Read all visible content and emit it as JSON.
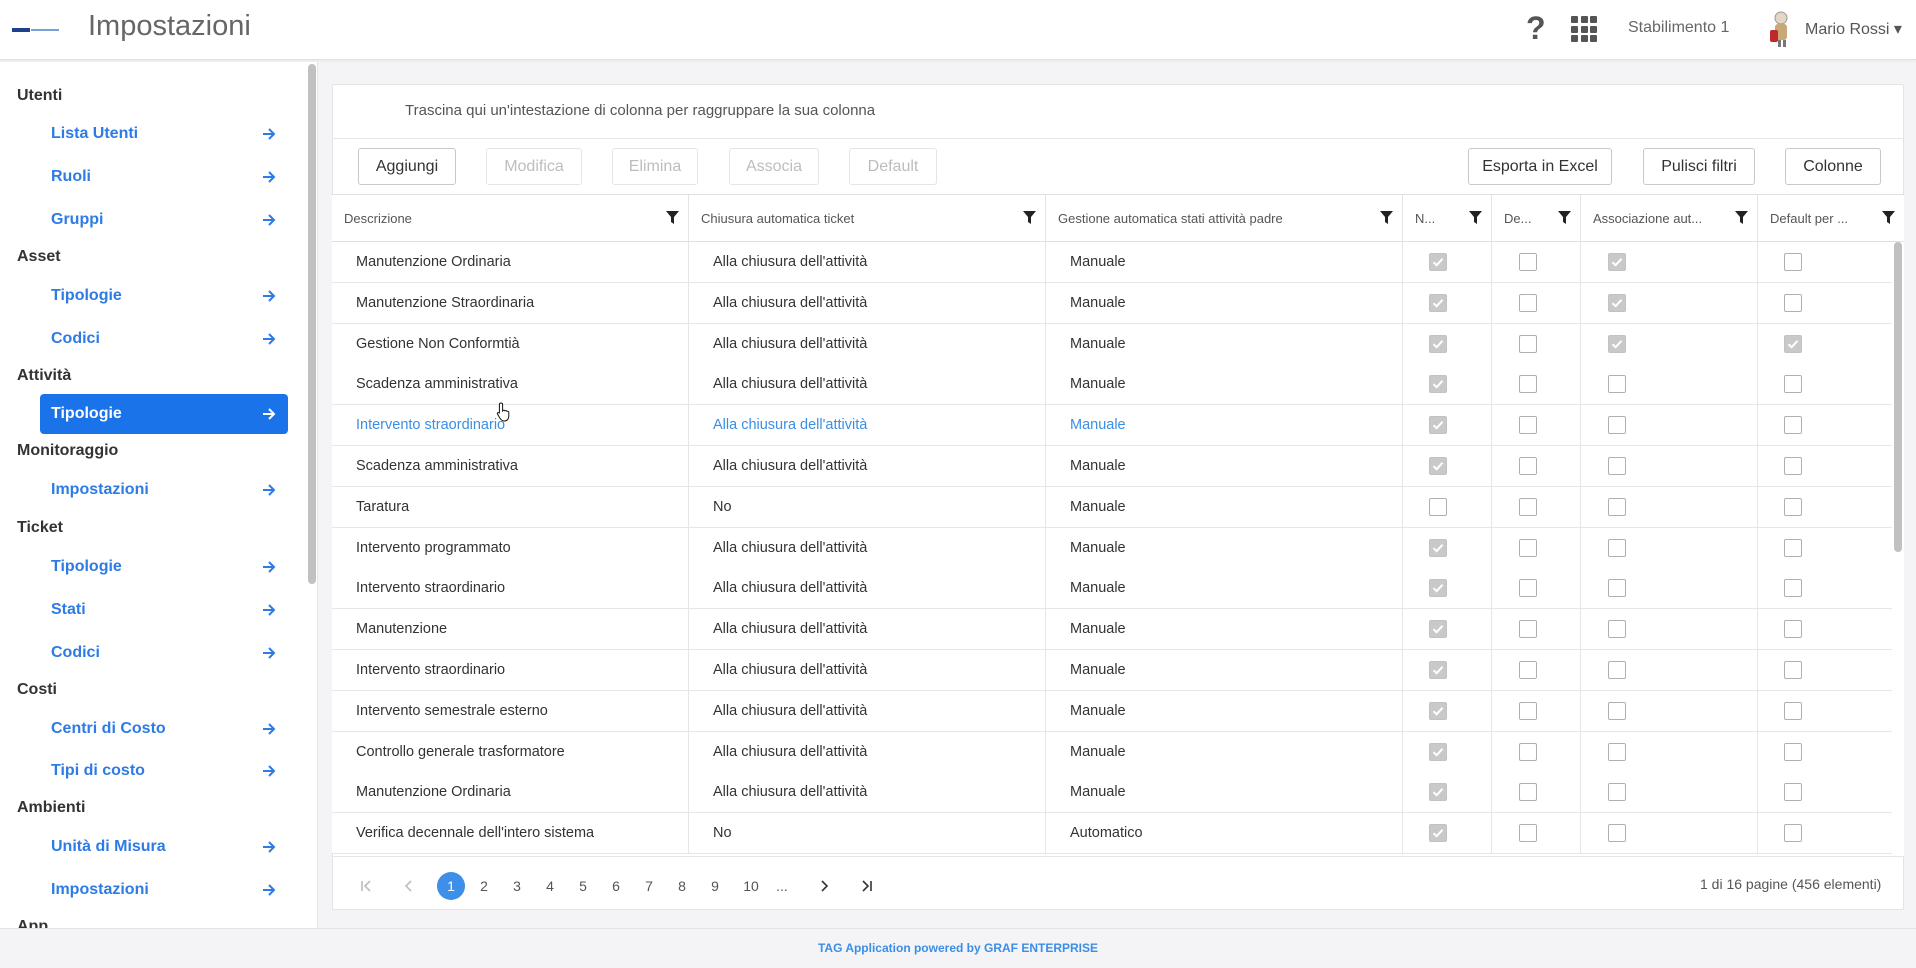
{
  "header": {
    "title": "Impostazioni",
    "help_symbol": "?",
    "plant": "Stabilimento 1",
    "user": "Mario Rossi ▾"
  },
  "sidebar": {
    "sections": [
      {
        "title": "Utenti",
        "items": [
          "Lista Utenti",
          "Ruoli",
          "Gruppi"
        ]
      },
      {
        "title": "Asset",
        "items": [
          "Tipologie",
          "Codici"
        ]
      },
      {
        "title": "Attività",
        "items": [
          "Tipologie"
        ]
      },
      {
        "title": "Monitoraggio",
        "items": [
          "Impostazioni"
        ]
      },
      {
        "title": "Ticket",
        "items": [
          "Tipologie",
          "Stati",
          "Codici"
        ]
      },
      {
        "title": "Costi",
        "items": [
          "Centri di Costo",
          "Tipi di costo"
        ]
      },
      {
        "title": "Ambienti",
        "items": [
          "Unità di Misura",
          "Impostazioni"
        ]
      },
      {
        "title": "App",
        "items": []
      }
    ],
    "active": "Attività/Tipologie"
  },
  "toolbar": {
    "group_hint": "Trascina qui un'intestazione di colonna per raggruppare la sua colonna",
    "add": "Aggiungi",
    "edit": "Modifica",
    "delete": "Elimina",
    "associate": "Associa",
    "default": "Default",
    "export": "Esporta in Excel",
    "clear_filters": "Pulisci filtri",
    "columns": "Colonne"
  },
  "grid": {
    "columns": [
      "Descrizione",
      "Chiusura automatica ticket",
      "Gestione automatica stati attività padre",
      "N...",
      "De...",
      "Associazione aut...",
      "Default per ..."
    ],
    "rows": [
      {
        "desc": "Manutenzione Ordinaria",
        "chiusura": "Alla chiusura dell'attività",
        "gestione": "Manuale",
        "n": true,
        "de": false,
        "assoc": true,
        "def": false
      },
      {
        "desc": "Manutenzione Straordinaria",
        "chiusura": "Alla chiusura dell'attività",
        "gestione": "Manuale",
        "n": true,
        "de": false,
        "assoc": true,
        "def": false
      },
      {
        "desc": "Gestione Non Conformtià",
        "chiusura": "Alla chiusura dell'attività",
        "gestione": "Manuale",
        "n": true,
        "de": false,
        "assoc": true,
        "def": true
      },
      {
        "desc": "Scadenza amministrativa",
        "chiusura": "Alla chiusura dell'attività",
        "gestione": "Manuale",
        "n": true,
        "de": false,
        "assoc": false,
        "def": false
      },
      {
        "desc": "Intervento straordinario",
        "chiusura": "Alla chiusura dell'attività",
        "gestione": "Manuale",
        "n": true,
        "de": false,
        "assoc": false,
        "def": false,
        "hover": true
      },
      {
        "desc": "Scadenza amministrativa",
        "chiusura": "Alla chiusura dell'attività",
        "gestione": "Manuale",
        "n": true,
        "de": false,
        "assoc": false,
        "def": false
      },
      {
        "desc": "Taratura",
        "chiusura": "No",
        "gestione": "Manuale",
        "n": false,
        "de": false,
        "assoc": false,
        "def": false
      },
      {
        "desc": "Intervento programmato",
        "chiusura": "Alla chiusura dell'attività",
        "gestione": "Manuale",
        "n": true,
        "de": false,
        "assoc": false,
        "def": false
      },
      {
        "desc": "Intervento straordinario",
        "chiusura": "Alla chiusura dell'attività",
        "gestione": "Manuale",
        "n": true,
        "de": false,
        "assoc": false,
        "def": false
      },
      {
        "desc": "Manutenzione",
        "chiusura": "Alla chiusura dell'attività",
        "gestione": "Manuale",
        "n": true,
        "de": false,
        "assoc": false,
        "def": false
      },
      {
        "desc": "Intervento straordinario",
        "chiusura": "Alla chiusura dell'attività",
        "gestione": "Manuale",
        "n": true,
        "de": false,
        "assoc": false,
        "def": false
      },
      {
        "desc": "Intervento semestrale esterno",
        "chiusura": "Alla chiusura dell'attività",
        "gestione": "Manuale",
        "n": true,
        "de": false,
        "assoc": false,
        "def": false
      },
      {
        "desc": "Controllo generale trasformatore",
        "chiusura": "Alla chiusura dell'attività",
        "gestione": "Manuale",
        "n": true,
        "de": false,
        "assoc": false,
        "def": false
      },
      {
        "desc": "Manutenzione Ordinaria",
        "chiusura": "Alla chiusura dell'attività",
        "gestione": "Manuale",
        "n": true,
        "de": false,
        "assoc": false,
        "def": false
      },
      {
        "desc": "Verifica decennale dell'intero sistema",
        "chiusura": "No",
        "gestione": "Automatico",
        "n": true,
        "de": false,
        "assoc": false,
        "def": false
      }
    ]
  },
  "pager": {
    "pages": [
      "1",
      "2",
      "3",
      "4",
      "5",
      "6",
      "7",
      "8",
      "9",
      "10",
      "..."
    ],
    "current": "1",
    "info": "1 di 16 pagine (456 elementi)"
  },
  "footer": {
    "text": "TAG Application powered by GRAF ENTERPRISE"
  },
  "colors": {
    "accent": "#1a73e8",
    "link": "#2d7be5",
    "hover_text": "#3a8ee6"
  }
}
